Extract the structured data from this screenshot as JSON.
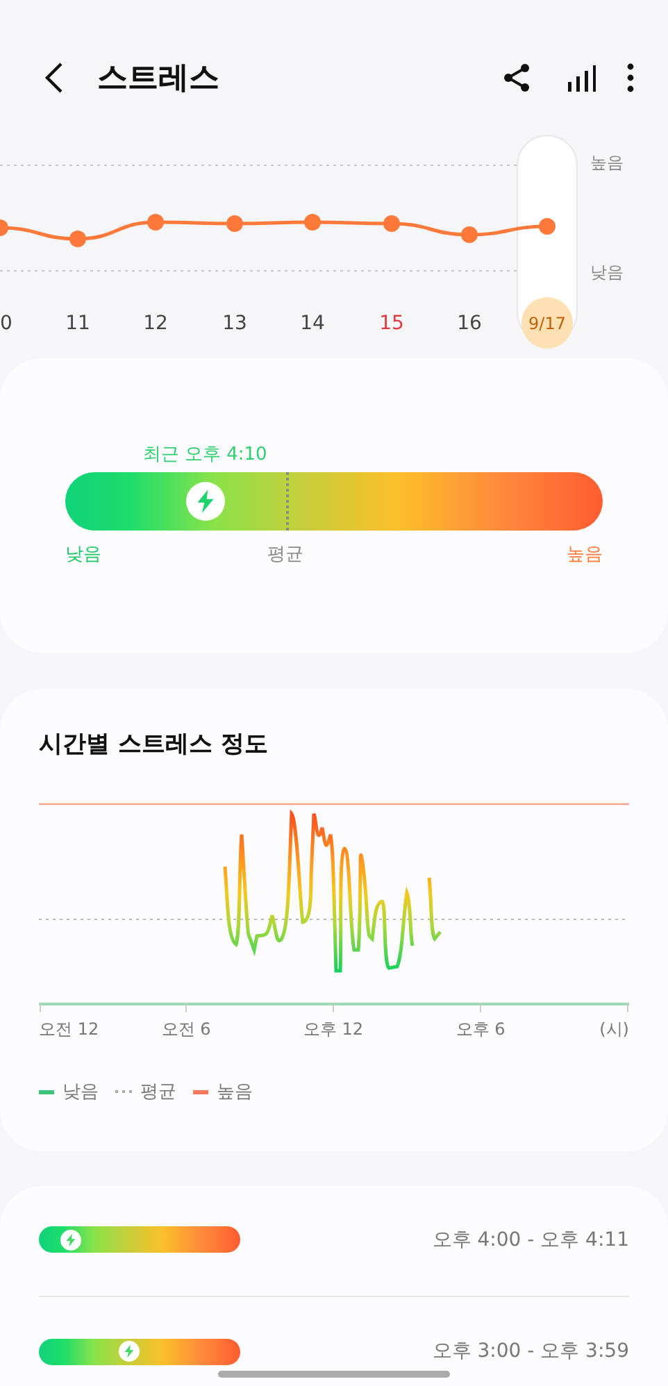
{
  "header": {
    "title": "스트레스"
  },
  "trend": {
    "high_label": "높음",
    "low_label": "낮음",
    "days": [
      {
        "label": "0",
        "holiday": false,
        "selected": false
      },
      {
        "label": "11",
        "holiday": false,
        "selected": false
      },
      {
        "label": "12",
        "holiday": false,
        "selected": false
      },
      {
        "label": "13",
        "holiday": false,
        "selected": false
      },
      {
        "label": "14",
        "holiday": false,
        "selected": false
      },
      {
        "label": "15",
        "holiday": true,
        "selected": false
      },
      {
        "label": "16",
        "holiday": false,
        "selected": false
      },
      {
        "label": "9/17",
        "holiday": false,
        "selected": true
      }
    ]
  },
  "summary": {
    "recent": "최근 오후 4:10",
    "level": 0.26,
    "average": {
      "level": 0.41
    },
    "low_label": "낮음",
    "average_label": "평균",
    "high_label": "높음"
  },
  "hourly": {
    "title": "시간별 스트레스 정도",
    "x_labels": [
      "오전 12",
      "오전 6",
      "오후 12",
      "오후 6",
      "(시)"
    ],
    "legend": [
      {
        "kind": "low",
        "label": "낮음"
      },
      {
        "kind": "average",
        "label": "평균"
      },
      {
        "kind": "high",
        "label": "높음"
      }
    ]
  },
  "records": [
    {
      "level": 0.16,
      "time": "오후 4:00 - 오후 4:11"
    },
    {
      "level": 0.45,
      "time": "오후 3:00 - 오후 3:59"
    }
  ]
}
